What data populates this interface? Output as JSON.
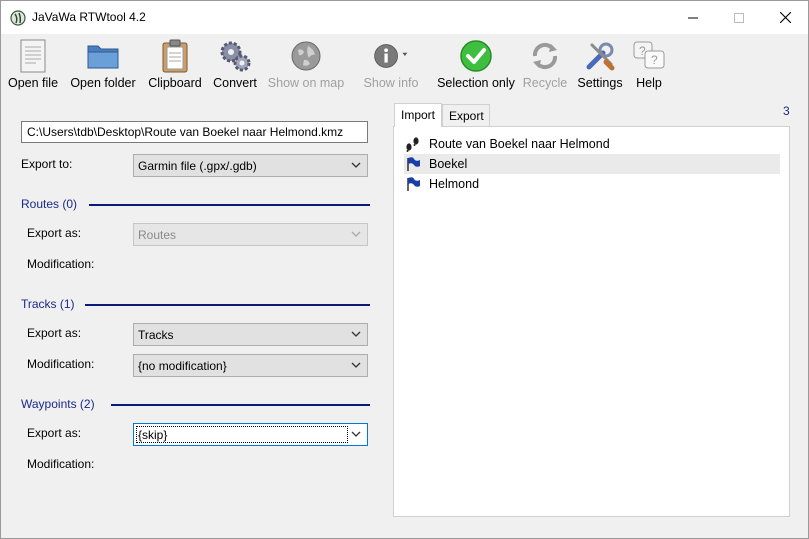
{
  "window": {
    "title": "JaVaWa RTWtool 4.2"
  },
  "toolbar": {
    "open_file": "Open file",
    "open_folder": "Open folder",
    "clipboard": "Clipboard",
    "convert": "Convert",
    "show_on_map": "Show on map",
    "show_info": "Show info",
    "selection_only": "Selection only",
    "recycle": "Recycle",
    "settings": "Settings",
    "help": "Help"
  },
  "left": {
    "file_path": "C:\\Users\\tdb\\Desktop\\Route van Boekel naar Helmond.kmz",
    "export_to_label": "Export to:",
    "export_to_value": "Garmin file (.gpx/.gdb)",
    "routes": {
      "heading": "Routes (0)",
      "export_as_label": "Export as:",
      "export_as_value": "Routes",
      "modification_label": "Modification:"
    },
    "tracks": {
      "heading": "Tracks (1)",
      "export_as_label": "Export as:",
      "export_as_value": "Tracks",
      "modification_label": "Modification:",
      "modification_value": "{no modification}"
    },
    "waypoints": {
      "heading": "Waypoints (2)",
      "export_as_label": "Export as:",
      "export_as_value": "{skip}",
      "modification_label": "Modification:"
    }
  },
  "right": {
    "count": "3",
    "tabs": [
      {
        "label": "Import"
      },
      {
        "label": "Export"
      }
    ],
    "items": [
      {
        "label": "Route van Boekel naar Helmond",
        "icon": "footsteps-icon"
      },
      {
        "label": "Boekel",
        "icon": "flag-icon"
      },
      {
        "label": "Helmond",
        "icon": "flag-icon"
      }
    ]
  },
  "colors": {
    "section_heading": "#1a2a8a",
    "accent_blue": "#0078d7"
  }
}
